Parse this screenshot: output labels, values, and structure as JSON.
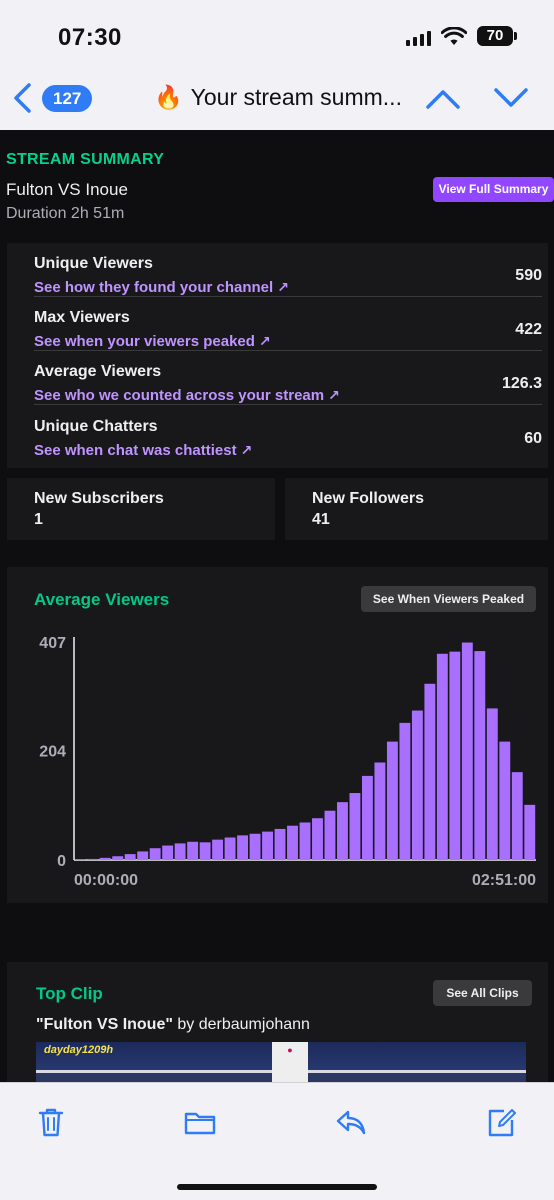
{
  "status_bar": {
    "time": "07:30",
    "battery": "70"
  },
  "mail_nav": {
    "unread_count": "127",
    "title": "Your stream summ...",
    "title_emoji": "🔥"
  },
  "summary": {
    "label": "STREAM SUMMARY",
    "stream_title": "Fulton VS Inoue",
    "duration": "Duration 2h 51m",
    "view_full_label": "View Full Summary"
  },
  "stats": [
    {
      "name": "Unique Viewers",
      "link": "See how they found your channel",
      "value": "590"
    },
    {
      "name": "Max Viewers",
      "link": "See when your viewers peaked",
      "value": "422"
    },
    {
      "name": "Average Viewers",
      "link": "See who we counted across your stream",
      "value": "126.3"
    },
    {
      "name": "Unique Chatters",
      "link": "See when chat was chattiest",
      "value": "60"
    }
  ],
  "new_subscribers": {
    "label": "New Subscribers",
    "value": "1"
  },
  "new_followers": {
    "label": "New Followers",
    "value": "41"
  },
  "chart_section": {
    "heading": "Average Viewers",
    "button_label": "See When Viewers Peaked"
  },
  "chart_data": {
    "type": "bar",
    "title": "Average Viewers",
    "xlabel": "",
    "ylabel": "",
    "y_ticks": [
      "407",
      "204",
      "0"
    ],
    "x_tick_labels": [
      "00:00:00",
      "02:51:00"
    ],
    "ylim": [
      0,
      407
    ],
    "grid": false,
    "bar_color": "#a970ff",
    "values": [
      1,
      2,
      4,
      7,
      11,
      16,
      22,
      27,
      31,
      34,
      33,
      38,
      42,
      46,
      49,
      53,
      58,
      64,
      70,
      78,
      92,
      108,
      125,
      157,
      182,
      221,
      256,
      279,
      329,
      385,
      389,
      406,
      390,
      283,
      221,
      164,
      103
    ]
  },
  "clip": {
    "heading": "Top Clip",
    "button_label": "See All Clips",
    "title": "\"Fulton VS Inoue\"",
    "by_label": "by derbaumjohann",
    "thumbnail_text": "dayday1209h"
  },
  "colors": {
    "accent": "#9147ff",
    "link": "#bf94ff",
    "heading_green": "#00f5a0",
    "ios_blue": "#2f7cf6"
  }
}
